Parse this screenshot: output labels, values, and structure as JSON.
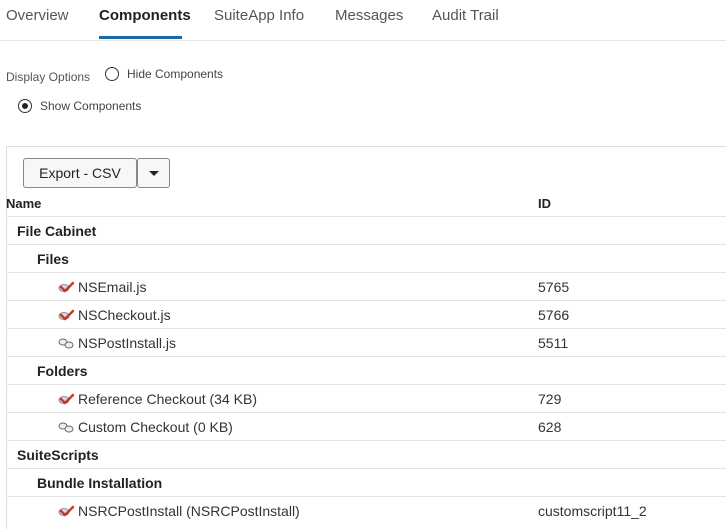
{
  "tabs": [
    {
      "label": "Overview"
    },
    {
      "label": "Components"
    },
    {
      "label": "SuiteApp Info"
    },
    {
      "label": "Messages"
    },
    {
      "label": "Audit Trail"
    }
  ],
  "display_options": {
    "label": "Display Options",
    "hide_label": "Hide Components",
    "show_label": "Show Components",
    "selected": "Show Components"
  },
  "toolbar": {
    "export_label": "Export - CSV"
  },
  "table": {
    "columns": [
      "Name",
      "ID"
    ],
    "rows": [
      {
        "name": "File Cabinet",
        "id": "",
        "level": 0,
        "icon": null
      },
      {
        "name": "Files",
        "id": "",
        "level": 1,
        "icon": null
      },
      {
        "name": "NSEmail.js",
        "id": "5765",
        "level": 2,
        "icon": "checkmark-component-icon"
      },
      {
        "name": "NSCheckout.js",
        "id": "5766",
        "level": 2,
        "icon": "checkmark-component-icon"
      },
      {
        "name": "NSPostInstall.js",
        "id": "5511",
        "level": 2,
        "icon": "link-component-icon"
      },
      {
        "name": "Folders",
        "id": "",
        "level": 1,
        "icon": null
      },
      {
        "name": "Reference Checkout (34 KB)",
        "id": "729",
        "level": 2,
        "icon": "checkmark-component-icon"
      },
      {
        "name": "Custom Checkout (0 KB)",
        "id": "628",
        "level": 2,
        "icon": "link-component-icon"
      },
      {
        "name": "SuiteScripts",
        "id": "",
        "level": 0,
        "icon": null
      },
      {
        "name": "Bundle Installation",
        "id": "",
        "level": 1,
        "icon": null
      },
      {
        "name": "NSRCPostInstall (NSRCPostInstall)",
        "id": "customscript11_2",
        "level": 2,
        "icon": "checkmark-component-icon"
      }
    ]
  },
  "colors": {
    "accent": "#1b6aa5",
    "check_icon": "#c0392b"
  }
}
